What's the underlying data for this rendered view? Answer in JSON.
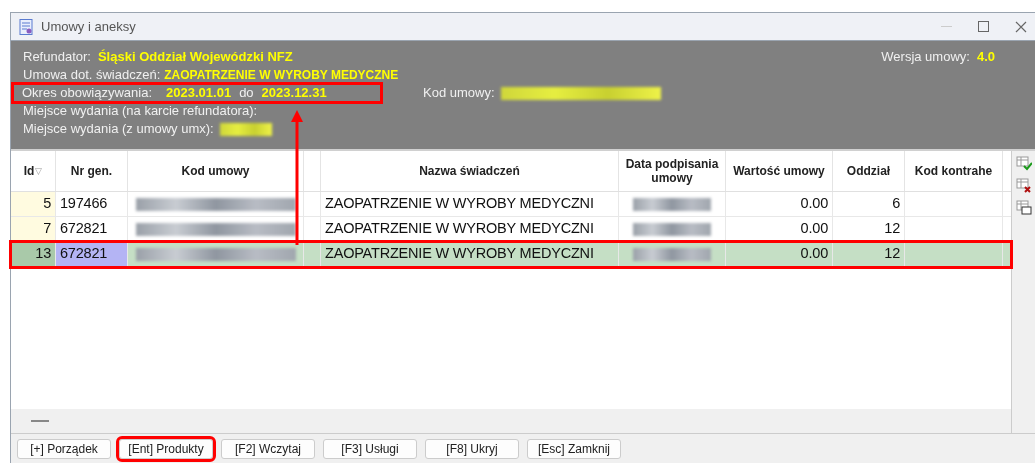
{
  "window": {
    "title": "Umowy i aneksy"
  },
  "header": {
    "refundator_label": "Refundator:",
    "refundator": "Śląski Oddział Wojewódzki NFZ",
    "version_label": "Wersja umowy:",
    "version": "4.0",
    "service_label": "Umowa dot. świadczeń:",
    "service": "ZAOPATRZENIE W WYROBY MEDYCZNE",
    "period_label": "Okres obowiązywania:",
    "period_from": "2023.01.01",
    "period_sep": "do",
    "period_to": "2023.12.31",
    "period_highlighted": true,
    "code_label": "Kod umowy:",
    "place_card_label": "Miejsce wydania (na karcie refundatora):",
    "place_umx_label": "Miejsce wydania (z umowy umx):"
  },
  "table": {
    "columns": [
      {
        "label": "Id",
        "kind": "id",
        "sort_mark": "▽"
      },
      {
        "label": "Nr gen.",
        "kind": "text"
      },
      {
        "label": "Kod umowy",
        "kind": "redacted"
      },
      {
        "kind": "blank"
      },
      {
        "label": "Nazwa świadczeń",
        "kind": "text"
      },
      {
        "label": "Data podpisania umowy",
        "kind": "redacted"
      },
      {
        "label": "Wartość umowy",
        "kind": "number"
      },
      {
        "label": "Oddział",
        "kind": "number"
      },
      {
        "label": "Kod kontrahe",
        "kind": "text"
      }
    ],
    "rows": [
      {
        "selected": false,
        "highlighted": false,
        "cells": [
          "5",
          "197466",
          "",
          "",
          "ZAOPATRZENIE W WYROBY MEDYCZNI",
          "",
          "0.00",
          "6",
          ""
        ]
      },
      {
        "selected": false,
        "highlighted": false,
        "cells": [
          "7",
          "672821",
          "",
          "",
          "ZAOPATRZENIE W WYROBY MEDYCZNI",
          "",
          "0.00",
          "12",
          ""
        ]
      },
      {
        "selected": true,
        "highlighted": true,
        "cells": [
          "13",
          "672821",
          "",
          "",
          "ZAOPATRZENIE W WYROBY MEDYCZNI",
          "",
          "0.00",
          "12",
          ""
        ]
      }
    ]
  },
  "buttons": [
    {
      "label": "[+] Porządek",
      "highlighted": false
    },
    {
      "label": "[Ent] Produkty",
      "highlighted": true
    },
    {
      "label": "[F2] Wczytaj",
      "highlighted": false
    },
    {
      "label": "[F3] Usługi",
      "highlighted": false
    },
    {
      "label": "[F8] Ukryj",
      "highlighted": false
    },
    {
      "label": "[Esc] Zamknij",
      "highlighted": false
    }
  ]
}
